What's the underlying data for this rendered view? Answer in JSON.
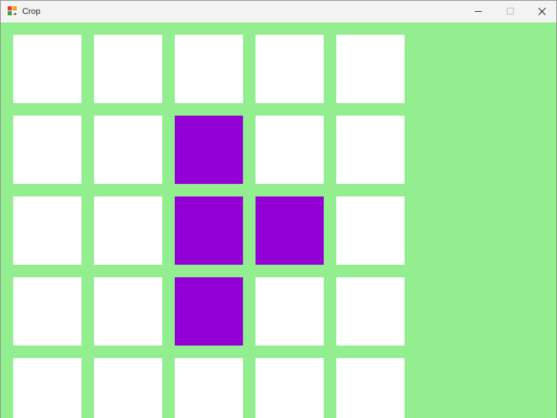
{
  "window": {
    "title": "Crop",
    "icon": "app-icon",
    "buttons": {
      "minimize_icon": "minimize-icon",
      "maximize_icon": "maximize-icon",
      "close_icon": "close-icon"
    }
  },
  "colors": {
    "background": "#93ee90",
    "empty": "#ffffff",
    "filled": "#9300d5",
    "titlebar": "#f3f3f3"
  },
  "grid": {
    "columns": 5,
    "rows": [
      [
        0,
        0,
        0,
        0,
        0
      ],
      [
        0,
        0,
        1,
        0,
        0
      ],
      [
        0,
        0,
        1,
        1,
        0
      ],
      [
        0,
        0,
        1,
        0,
        0
      ],
      [
        0,
        0,
        0,
        0,
        0
      ]
    ]
  }
}
